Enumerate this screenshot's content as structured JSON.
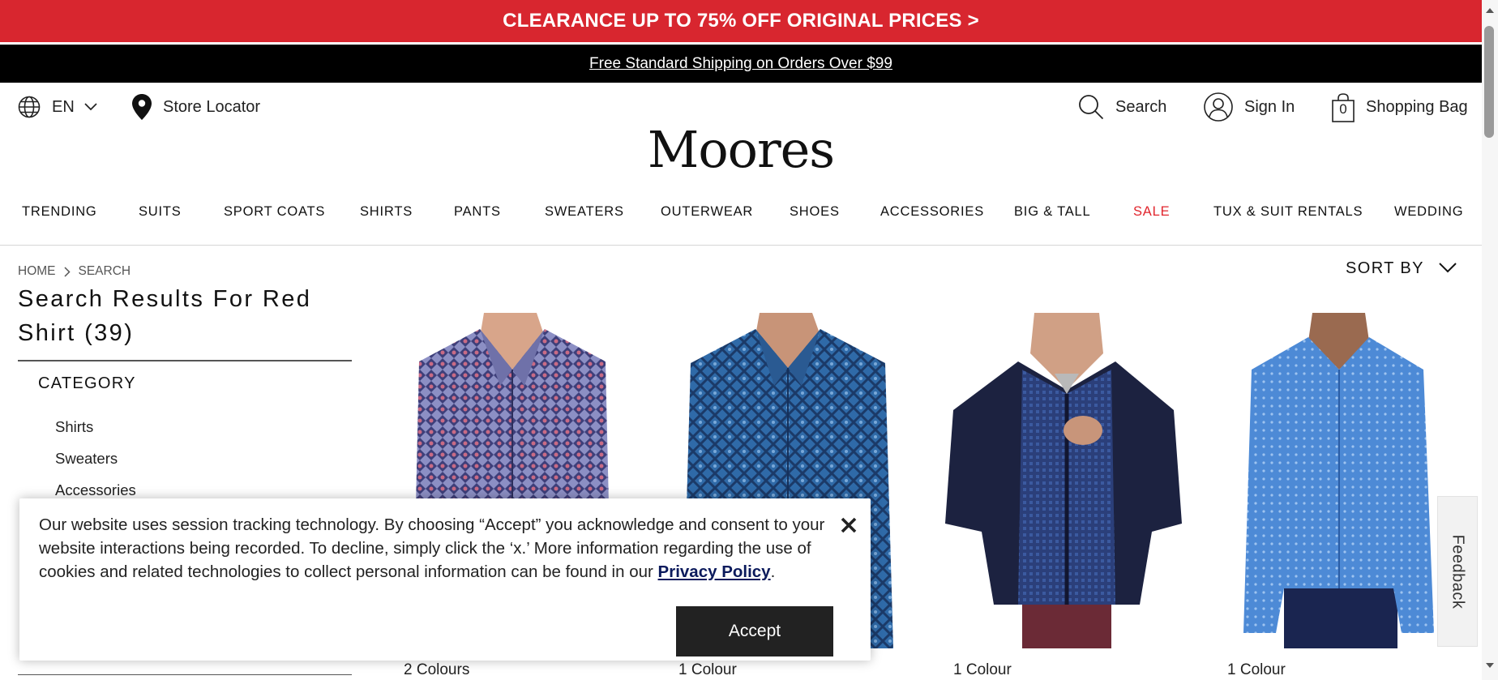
{
  "promo": {
    "text": "CLEARANCE UP TO 75% OFF ORIGINAL PRICES >"
  },
  "shipping": {
    "text": "Free Standard Shipping on Orders Over $99"
  },
  "utility": {
    "language": "EN",
    "store_locator": "Store Locator",
    "search": "Search",
    "sign_in": "Sign In",
    "bag_label": "Shopping Bag",
    "bag_count": "0"
  },
  "logo": "Moores",
  "nav": {
    "items": [
      {
        "label": "TRENDING"
      },
      {
        "label": "SUITS"
      },
      {
        "label": "SPORT COATS"
      },
      {
        "label": "SHIRTS"
      },
      {
        "label": "PANTS"
      },
      {
        "label": "SWEATERS"
      },
      {
        "label": "OUTERWEAR"
      },
      {
        "label": "SHOES"
      },
      {
        "label": "ACCESSORIES"
      },
      {
        "label": "BIG & TALL"
      },
      {
        "label": "SALE"
      },
      {
        "label": "TUX & SUIT RENTALS"
      },
      {
        "label": "WEDDING"
      }
    ]
  },
  "breadcrumb": {
    "home": "HOME",
    "current": "SEARCH"
  },
  "results": {
    "title": "Search Results For Red Shirt (39)"
  },
  "filters": {
    "category_title": "CATEGORY",
    "items": [
      {
        "label": "Shirts"
      },
      {
        "label": "Sweaters"
      },
      {
        "label": "Accessories"
      }
    ]
  },
  "sort": {
    "label": "SORT BY"
  },
  "products": [
    {
      "colours": "2 Colours"
    },
    {
      "colours": "1 Colour"
    },
    {
      "colours": "1 Colour"
    },
    {
      "colours": "1 Colour"
    }
  ],
  "feedback": "Feedback",
  "cookie": {
    "text": "Our website uses session tracking technology. By choosing “Accept” you acknowledge and consent to your website interactions being recorded. To decline, simply click the ‘x.’ More information regarding the use of cookies and related technologies to collect personal information can be found in our ",
    "link": "Privacy Policy",
    "tail": ".",
    "accept": "Accept"
  },
  "colors": {
    "promo_red": "#d8262f",
    "sale_red": "#e1252d",
    "black": "#000000",
    "accept_bg": "#222222",
    "privacy_link": "#0b1a5c"
  },
  "icons": [
    "globe-icon",
    "chevron-down-icon",
    "location-pin-icon",
    "search-icon",
    "user-icon",
    "shopping-bag-icon",
    "chevron-right-icon",
    "close-icon"
  ]
}
